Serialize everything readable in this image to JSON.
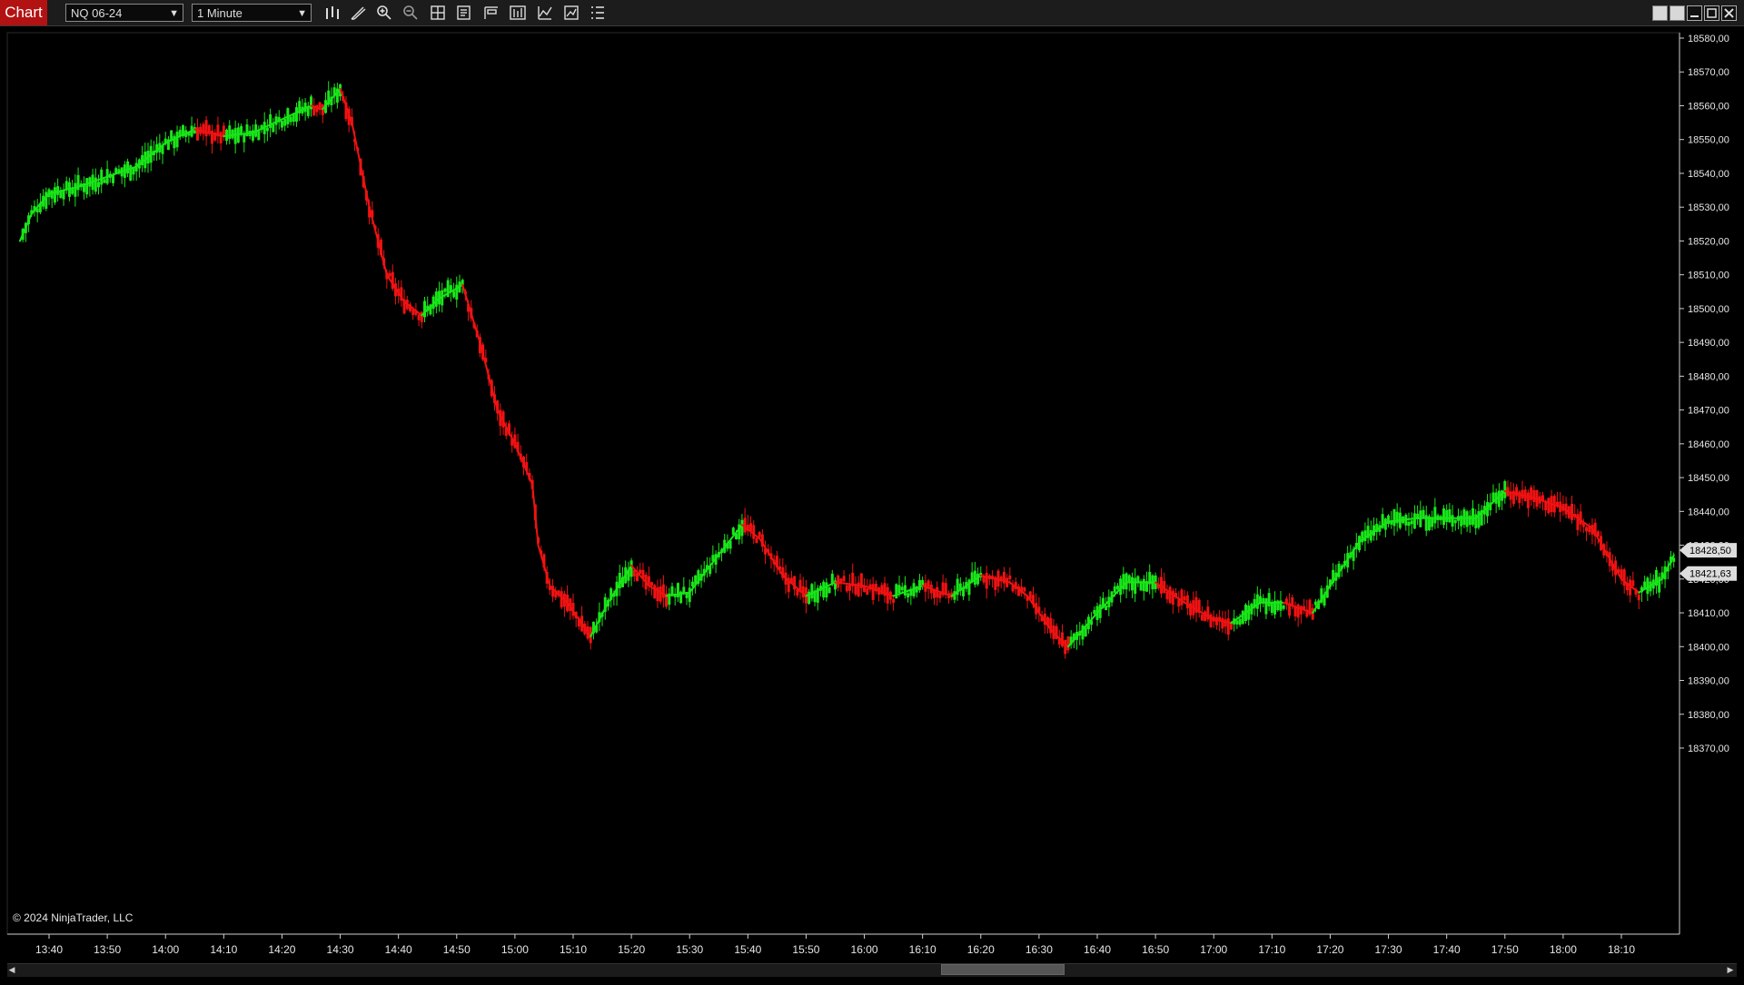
{
  "app": {
    "title": "Chart"
  },
  "toolbar": {
    "instrument": "NQ 06-24",
    "interval": "1 Minute",
    "icons": [
      "bar-type-icon",
      "draw-pencil-icon",
      "zoom-in-icon",
      "zoom-out-icon",
      "crosshair-icon",
      "data-box-icon",
      "properties-icon",
      "chart-trader-icon",
      "indicators-icon",
      "strategies-icon",
      "object-list-icon"
    ]
  },
  "colors": {
    "up": "#19e619",
    "down": "#f01212",
    "background": "#000000",
    "axis": "#1a1a1a"
  },
  "chart_data": {
    "type": "candlestick",
    "y_labels": [
      "18580,00",
      "18570,00",
      "18560,00",
      "18550,00",
      "18540,00",
      "18530,00",
      "18520,00",
      "18510,00",
      "18500,00",
      "18490,00",
      "18480,00",
      "18470,00",
      "18460,00",
      "18450,00",
      "18440,00",
      "18430,00",
      "18420,00",
      "18410,00",
      "18400,00",
      "18390,00",
      "18380,00",
      "18370,00"
    ],
    "x_labels": [
      "13:40",
      "13:50",
      "14:00",
      "14:10",
      "14:20",
      "14:30",
      "14:40",
      "14:50",
      "15:00",
      "15:10",
      "15:20",
      "15:30",
      "15:40",
      "15:50",
      "16:00",
      "16:10",
      "16:20",
      "16:30",
      "16:40",
      "16:50",
      "17:00",
      "17:10",
      "17:20",
      "17:30",
      "17:40",
      "17:50",
      "18:00",
      "18:10"
    ],
    "ylim": [
      18366,
      18584
    ],
    "price_markers": [
      {
        "label": "18428,50",
        "value": 18428.5,
        "color": "#dddddd"
      },
      {
        "label": "18421,63",
        "value": 18421.63,
        "color": "#dddddd"
      }
    ],
    "ma_series": [
      {
        "time": "13:35",
        "value": 18520
      },
      {
        "time": "13:37",
        "value": 18528
      },
      {
        "time": "13:40",
        "value": 18534
      },
      {
        "time": "13:45",
        "value": 18536
      },
      {
        "time": "13:50",
        "value": 18539
      },
      {
        "time": "13:55",
        "value": 18542
      },
      {
        "time": "14:00",
        "value": 18549
      },
      {
        "time": "14:05",
        "value": 18553
      },
      {
        "time": "14:10",
        "value": 18551
      },
      {
        "time": "14:15",
        "value": 18552
      },
      {
        "time": "14:20",
        "value": 18556
      },
      {
        "time": "14:25",
        "value": 18560
      },
      {
        "time": "14:27",
        "value": 18559
      },
      {
        "time": "14:30",
        "value": 18565
      },
      {
        "time": "14:32",
        "value": 18555
      },
      {
        "time": "14:35",
        "value": 18530
      },
      {
        "time": "14:38",
        "value": 18510
      },
      {
        "time": "14:41",
        "value": 18502
      },
      {
        "time": "14:44",
        "value": 18498
      },
      {
        "time": "14:47",
        "value": 18503
      },
      {
        "time": "14:51",
        "value": 18507
      },
      {
        "time": "14:54",
        "value": 18490
      },
      {
        "time": "14:57",
        "value": 18470
      },
      {
        "time": "15:00",
        "value": 18460
      },
      {
        "time": "15:03",
        "value": 18448
      },
      {
        "time": "15:04",
        "value": 18430
      },
      {
        "time": "15:06",
        "value": 18418
      },
      {
        "time": "15:09",
        "value": 18413
      },
      {
        "time": "15:11",
        "value": 18408
      },
      {
        "time": "15:13",
        "value": 18403
      },
      {
        "time": "15:16",
        "value": 18413
      },
      {
        "time": "15:20",
        "value": 18424
      },
      {
        "time": "15:23",
        "value": 18418
      },
      {
        "time": "15:26",
        "value": 18415
      },
      {
        "time": "15:30",
        "value": 18416
      },
      {
        "time": "15:34",
        "value": 18425
      },
      {
        "time": "15:39",
        "value": 18436
      },
      {
        "time": "15:42",
        "value": 18432
      },
      {
        "time": "15:46",
        "value": 18421
      },
      {
        "time": "15:50",
        "value": 18415
      },
      {
        "time": "15:55",
        "value": 18419
      },
      {
        "time": "16:00",
        "value": 18418
      },
      {
        "time": "16:05",
        "value": 18415
      },
      {
        "time": "16:10",
        "value": 18418
      },
      {
        "time": "16:15",
        "value": 18415
      },
      {
        "time": "16:20",
        "value": 18421
      },
      {
        "time": "16:25",
        "value": 18419
      },
      {
        "time": "16:28",
        "value": 18415
      },
      {
        "time": "16:32",
        "value": 18405
      },
      {
        "time": "16:35",
        "value": 18400
      },
      {
        "time": "16:40",
        "value": 18410
      },
      {
        "time": "16:45",
        "value": 18419
      },
      {
        "time": "16:50",
        "value": 18419
      },
      {
        "time": "16:55",
        "value": 18413
      },
      {
        "time": "17:00",
        "value": 18408
      },
      {
        "time": "17:03",
        "value": 18407
      },
      {
        "time": "17:08",
        "value": 18413
      },
      {
        "time": "17:12",
        "value": 18413
      },
      {
        "time": "17:17",
        "value": 18410
      },
      {
        "time": "17:20",
        "value": 18418
      },
      {
        "time": "17:25",
        "value": 18431
      },
      {
        "time": "17:30",
        "value": 18437
      },
      {
        "time": "17:35",
        "value": 18438
      },
      {
        "time": "17:40",
        "value": 18438
      },
      {
        "time": "17:45",
        "value": 18438
      },
      {
        "time": "17:50",
        "value": 18446
      },
      {
        "time": "17:55",
        "value": 18444
      },
      {
        "time": "18:00",
        "value": 18441
      },
      {
        "time": "18:05",
        "value": 18435
      },
      {
        "time": "18:10",
        "value": 18420
      },
      {
        "time": "18:13",
        "value": 18416
      },
      {
        "time": "18:17",
        "value": 18420
      },
      {
        "time": "18:19",
        "value": 18427
      }
    ]
  },
  "footer": {
    "copyright": "© 2024 NinjaTrader, LLC"
  }
}
